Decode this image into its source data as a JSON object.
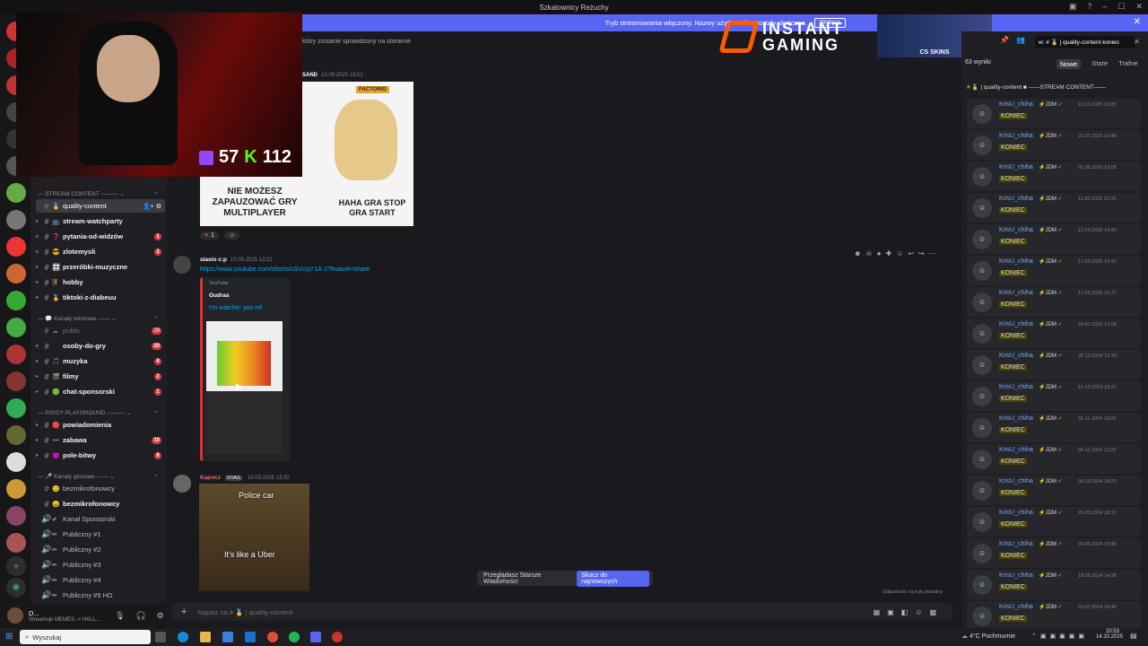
{
  "titlebar": {
    "title": "Szkalownicy Reżuchy"
  },
  "banner": {
    "text": "Tryb streamowania włączony. Nazwy użytkownika zostały skrócone.",
    "button": "Wyłącz"
  },
  "webcam": {
    "counter1": "57",
    "counter2": "112"
  },
  "sponsor": {
    "name1": "INSTANT",
    "name2": "GAMING",
    "cs": "CS SKINS"
  },
  "channels": {
    "cat_stream": "STREAM CONTENT",
    "cat_text": "Kanały tekstowe",
    "cat_piggy": "PIGGY PLAYGROUND",
    "cat_voice": "Kanały głosowe",
    "items": [
      {
        "label": "quality-content",
        "emoji": "🏅",
        "badge": ""
      },
      {
        "label": "stream-watchparty",
        "emoji": "📺",
        "badge": ""
      },
      {
        "label": "pytania-od-widzów",
        "emoji": "❓",
        "badge": "1"
      },
      {
        "label": "zlotemysli",
        "emoji": "😎",
        "badge": "3"
      },
      {
        "label": "przeróbki-muzyczne",
        "emoji": "🎛",
        "badge": ""
      },
      {
        "label": "hobby",
        "emoji": "🧗",
        "badge": ""
      },
      {
        "label": "tiktoki-z-diabeuu",
        "emoji": "🏅",
        "badge": ""
      },
      {
        "label": "public",
        "emoji": "☁",
        "badge": "29"
      },
      {
        "label": "osoby-do-gry",
        "emoji": "",
        "badge": "20"
      },
      {
        "label": "muzyka",
        "emoji": "🎵",
        "badge": "4"
      },
      {
        "label": "filmy",
        "emoji": "🎬",
        "badge": "2"
      },
      {
        "label": "chat-sponsorski",
        "emoji": "🟢",
        "badge": "1"
      },
      {
        "label": "powiadomienia",
        "emoji": "🔴",
        "badge": ""
      },
      {
        "label": "zabawa",
        "emoji": "➖",
        "badge": "10"
      },
      {
        "label": "pole-bitwy",
        "emoji": "👿",
        "badge": "8"
      },
      {
        "label": "bezmikrofonowcy",
        "emoji": "🤐",
        "badge": ""
      },
      {
        "label": "bezmikrofonowcy",
        "emoji": "😀",
        "badge": ""
      },
      {
        "label": "Kanał Sponsorski",
        "emoji": "✔",
        "badge": ""
      },
      {
        "label": "Publiczny #1",
        "emoji": "✏",
        "badge": ""
      },
      {
        "label": "Publiczny #2",
        "emoji": "✏",
        "badge": ""
      },
      {
        "label": "Publiczny #3",
        "emoji": "✏",
        "badge": ""
      },
      {
        "label": "Publiczny #4",
        "emoji": "✏",
        "badge": ""
      },
      {
        "label": "Publiczny #5 HD",
        "emoji": "✏",
        "badge": ""
      }
    ]
  },
  "user": {
    "name": "D...",
    "status": "Streamuje MEMES -> HALL..."
  },
  "main": {
    "banner_snippet": "który zostanie sprawdzony na streamie",
    "msg0": {
      "author": "SAND",
      "time": "10.09.2025 13:02"
    },
    "meme1": {
      "tag": "FACTORIO",
      "left": "NIE MOŻESZ ZAPAUZOWAĆ GRY MULTIPLAYER",
      "right": "HAHA GRA STOP GRA START"
    },
    "reaction": {
      "count": "1"
    },
    "msg1": {
      "author": "siasio c:p",
      "time": "10.09.2025 13:21",
      "link": "https://www.youtube.com/shorts/uSVccjY1A-1?feature=share",
      "provider": "YouTube",
      "channel": "Gudras",
      "title": "I'm watchin' you mf"
    },
    "msg2": {
      "author": "Kapocz",
      "tag": "OTAG",
      "time": "10.09.2025 13:32",
      "gif_top": "Police car",
      "gif_bottom": "It's like a Uber"
    },
    "jump_text": "Przeglądasz Starsze Wiadomości",
    "jump_button": "Skocz do najnowszych",
    "slowmode": "Odporność na tryb powolny",
    "input_placeholder": "Napisz na # 🏅 | quality-content"
  },
  "search": {
    "query": "w: # 🏅 | quality-content  koniec",
    "count": "63 wyniki",
    "tabs": [
      "Nowe",
      "Stare",
      "Trafne"
    ],
    "channel": "# 🏅 | quality-content ■ ——STREAM CONTENT——",
    "results": [
      {
        "name": "KrisU_chiha",
        "date": "11.10.2025 16:05",
        "body": "KONIEC"
      },
      {
        "name": "KrisU_chiha",
        "date": "22.07.2025 13:48",
        "body": "KONIEC"
      },
      {
        "name": "KrisU_chiha",
        "date": "05.06.2025 19:05",
        "body": "KONIEC"
      },
      {
        "name": "KrisU_chiha",
        "date": "11.05.2025 20:25",
        "body": "KONIEC"
      },
      {
        "name": "KrisU_chiha",
        "date": "12.04.2025 14:43",
        "body": "KONIEC"
      },
      {
        "name": "KrisU_chiha",
        "date": "17.03.2025 19:47",
        "body": "KONIEC"
      },
      {
        "name": "KrisU_chiha",
        "date": "17.02.2025 16:37",
        "body": "KONIEC"
      },
      {
        "name": "KrisU_chiha",
        "date": "24.01.2025 12:08",
        "body": "KONIEC"
      },
      {
        "name": "KrisU_chiha",
        "date": "28.12.2024 16:29",
        "body": "KONIEC"
      },
      {
        "name": "KrisU_chiha",
        "date": "16.12.2024 18:22",
        "body": "KONIEC"
      },
      {
        "name": "KrisU_chiha",
        "date": "26.11.2024 18:05",
        "body": "KONIEC"
      },
      {
        "name": "KrisU_chiha",
        "date": "04.11.2024 13:23",
        "body": "KONIEC"
      },
      {
        "name": "KrisU_chiha",
        "date": "09.10.2024 18:25",
        "body": "KONIEC"
      },
      {
        "name": "KrisU_chiha",
        "date": "26.09.2024 18:17",
        "body": "KONIEC"
      },
      {
        "name": "KrisU_chiha",
        "date": "04.09.2024 16:46",
        "body": "KONIEC"
      },
      {
        "name": "KrisU_chiha",
        "date": "18.08.2024 14:38",
        "body": "KONIEC"
      },
      {
        "name": "KrisU_chiha",
        "date": "29.07.2024 19:48",
        "body": "KONIEC"
      }
    ]
  },
  "taskbar": {
    "search": "Wyszukaj",
    "weather": "4°C Pochmurnie",
    "time": "20:53",
    "date": "14.10.2025"
  }
}
